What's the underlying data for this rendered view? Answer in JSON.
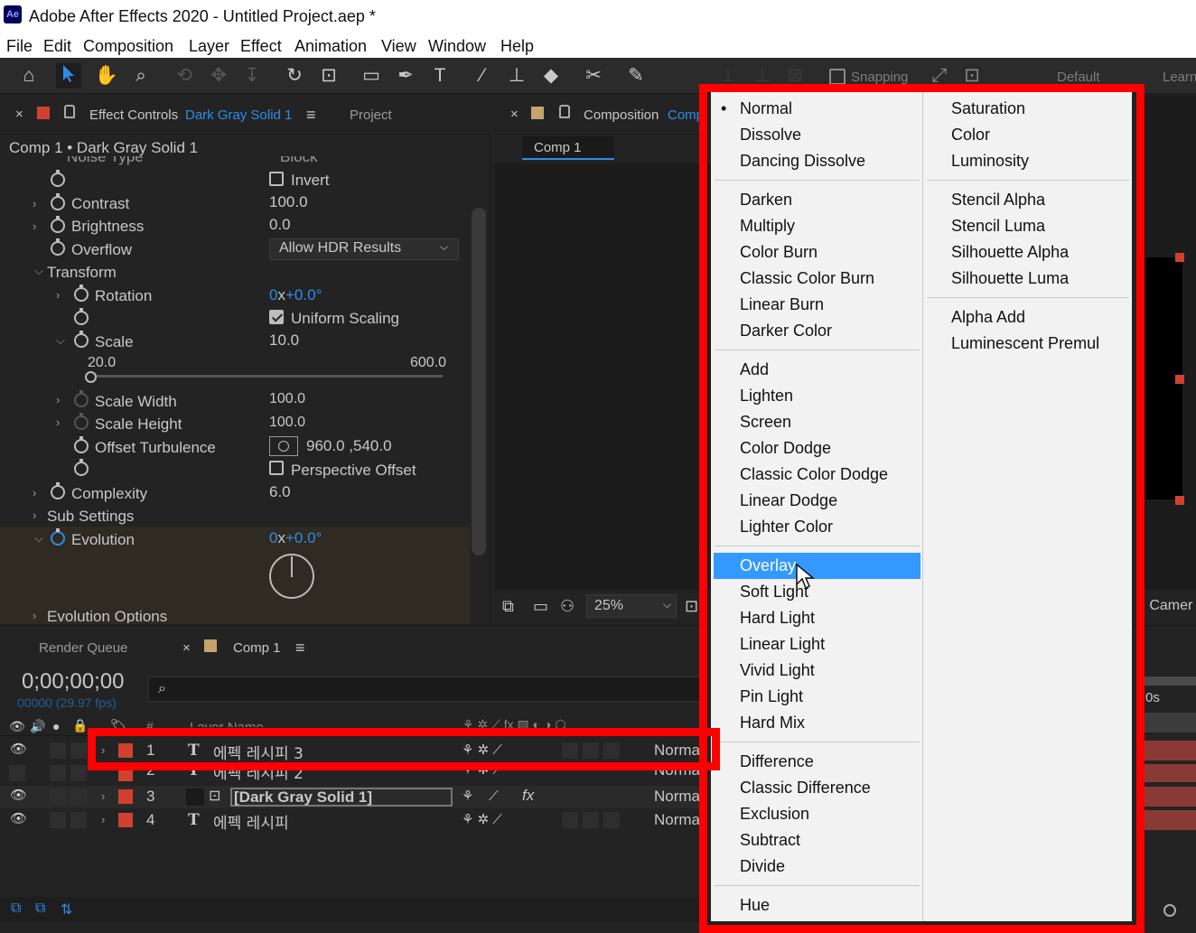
{
  "app": {
    "logo": "Ae",
    "title": "Adobe After Effects 2020 - Untitled Project.aep *"
  },
  "menu": [
    "File",
    "Edit",
    "Composition",
    "Layer",
    "Effect",
    "Animation",
    "View",
    "Window",
    "Help"
  ],
  "toolbar": {
    "snapping": "Snapping",
    "workspace": "Default",
    "learn": "Learn"
  },
  "effect_panel": {
    "close": "×",
    "tab": "Effect Controls",
    "layer": "Dark Gray Solid 1",
    "menu_icon": "≡",
    "other_tab": "Project",
    "breadcrumb": "Comp 1 • Dark Gray Solid 1",
    "noise_type_label": "Noise Type",
    "noise_type_value": "Block",
    "invert": "Invert",
    "contrast": {
      "label": "Contrast",
      "value": "100.0"
    },
    "brightness": {
      "label": "Brightness",
      "value": "0.0"
    },
    "overflow": {
      "label": "Overflow",
      "value": "Allow HDR Results"
    },
    "transform": "Transform",
    "rotation": {
      "label": "Rotation",
      "rev": "0",
      "x": "x",
      "deg": "+0.0",
      "degsign": "°"
    },
    "uniform_scaling": "Uniform Scaling",
    "scale": {
      "label": "Scale",
      "value": "10.0",
      "min": "20.0",
      "max": "600.0"
    },
    "scale_width": {
      "label": "Scale Width",
      "value": "100.0"
    },
    "scale_height": {
      "label": "Scale Height",
      "value": "100.0"
    },
    "offset_turbulence": {
      "label": "Offset Turbulence",
      "value": "960.0 ,540.0"
    },
    "perspective_offset": "Perspective Offset",
    "complexity": {
      "label": "Complexity",
      "value": "6.0"
    },
    "sub_settings": "Sub Settings",
    "evolution": {
      "label": "Evolution",
      "rev": "0",
      "x": "x",
      "deg": "+0.0",
      "degsign": "°"
    },
    "evolution_options": "Evolution Options"
  },
  "comp_panel": {
    "close": "×",
    "tab": "Composition",
    "tab_name": "Comp",
    "comp_tab": "Comp 1",
    "zoom": "25%",
    "camera": "e Camer"
  },
  "timeline": {
    "render_queue": "Render Queue",
    "close": "×",
    "comp_tab": "Comp 1",
    "menu_icon": "≡",
    "timecode": "0;00;00;00",
    "frames": "00000 (29.97 fps)",
    "col_num": "#",
    "col_name": "Layer Name",
    "time_label": "0s",
    "layers": [
      {
        "num": "1",
        "type": "T",
        "name": "에펙 레시피 3",
        "mode": "Normal"
      },
      {
        "num": "2",
        "type": "T",
        "name": "에펙 레시피 2",
        "mode": "Norma"
      },
      {
        "num": "3",
        "type": "",
        "name": "[Dark Gray Solid 1]",
        "mode": "Norma",
        "fx": "fx"
      },
      {
        "num": "4",
        "type": "T",
        "name": "에펙 레시피",
        "mode": "Norma"
      }
    ]
  },
  "dropdown": {
    "selected_marker": "•",
    "col1": [
      [
        "Normal",
        "Dissolve",
        "Dancing Dissolve"
      ],
      [
        "Darken",
        "Multiply",
        "Color Burn",
        "Classic Color Burn",
        "Linear Burn",
        "Darker Color"
      ],
      [
        "Add",
        "Lighten",
        "Screen",
        "Color Dodge",
        "Classic Color Dodge",
        "Linear Dodge",
        "Lighter Color"
      ],
      [
        "Overlay",
        "Soft Light",
        "Hard Light",
        "Linear Light",
        "Vivid Light",
        "Pin Light",
        "Hard Mix"
      ],
      [
        "Difference",
        "Classic Difference",
        "Exclusion",
        "Subtract",
        "Divide"
      ],
      [
        "Hue"
      ]
    ],
    "col2": [
      [
        "Saturation",
        "Color",
        "Luminosity"
      ],
      [
        "Stencil Alpha",
        "Stencil Luma",
        "Silhouette Alpha",
        "Silhouette Luma"
      ],
      [
        "Alpha Add",
        "Luminescent Premul"
      ]
    ],
    "highlighted": "Overlay"
  },
  "colors": {
    "accent": "#2d8ceb",
    "highlight": "#3399ff",
    "annotation": "#ff0000",
    "label_red": "#d0412f"
  }
}
